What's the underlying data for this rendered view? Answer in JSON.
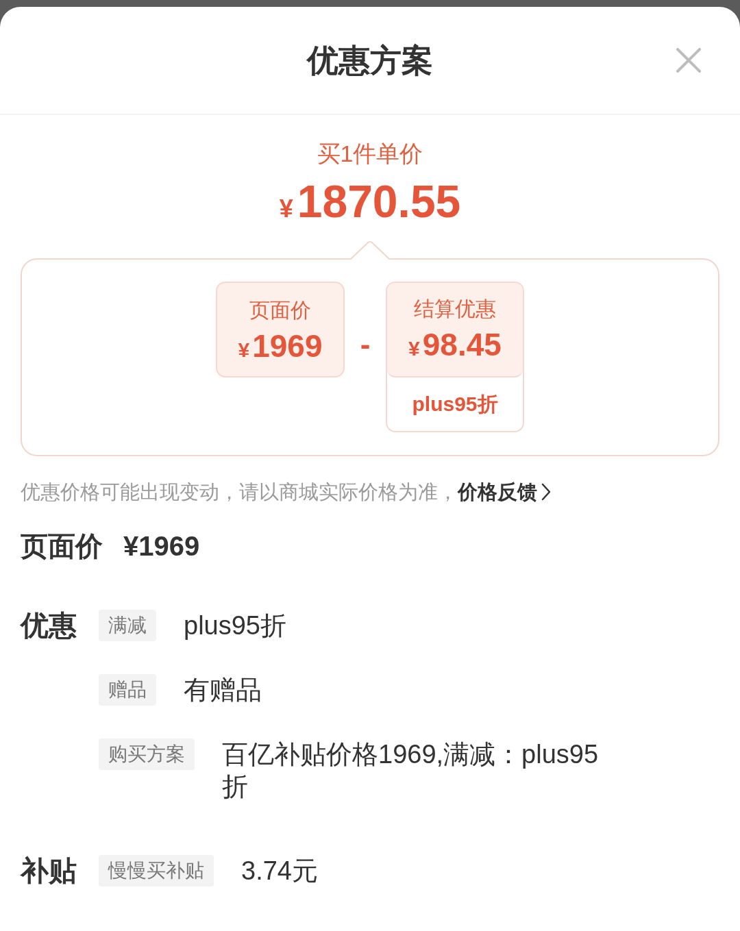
{
  "header": {
    "title": "优惠方案"
  },
  "summary": {
    "caption": "买1件单价",
    "currency": "¥",
    "amount": "1870.55"
  },
  "breakdown": [
    {
      "kind": "price",
      "label": "页面价",
      "currency": "¥",
      "amount": "1969"
    },
    {
      "kind": "operator",
      "symbol": "-"
    },
    {
      "kind": "discount",
      "label": "结算优惠",
      "currency": "¥",
      "amount": "98.45",
      "note": "plus95折"
    }
  ],
  "notice": {
    "text": "优惠价格可能出现变动，请以商城实际价格为准，",
    "link": "价格反馈"
  },
  "page_price": {
    "label": "页面价",
    "value": "¥1969"
  },
  "sections": [
    {
      "title": "优惠",
      "rows": [
        {
          "tag": "满减",
          "value": "plus95折"
        },
        {
          "tag": "赠品",
          "value": "有赠品"
        },
        {
          "tag": "购买方案",
          "value": "百亿补贴价格1969,满减：plus95折"
        }
      ]
    },
    {
      "title": "补贴",
      "rows": [
        {
          "tag": "慢慢买补贴",
          "value": "3.74元"
        }
      ]
    }
  ]
}
